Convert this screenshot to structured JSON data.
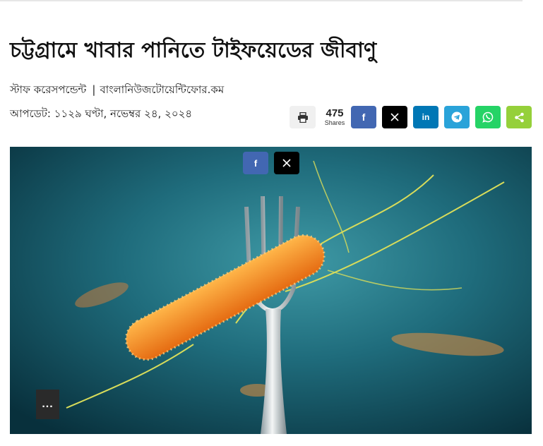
{
  "article": {
    "headline": "চট্টগ্রামে খাবার পানিতে টাইফয়েডের জীবাণু",
    "author": "স্টাফ করেসপন্ডেন্ট",
    "separator": "|",
    "source": "বাংলানিউজটোয়েন্টিফোর.কম",
    "updated": "আপডেট: ১১২৯ ঘণ্টা, নভেম্বর ২৪, ২০২৪"
  },
  "share_bar": {
    "count": "475",
    "count_label": "Shares",
    "buttons": [
      {
        "network": "facebook",
        "icon": "f",
        "color": "#4267b2"
      },
      {
        "network": "twitter",
        "icon": "𝕏",
        "color": "#000000"
      },
      {
        "network": "linkedin",
        "icon": "in",
        "color": "#0077b5"
      },
      {
        "network": "telegram",
        "icon": "telegram-icon",
        "color": "#2aa3d9"
      },
      {
        "network": "whatsapp",
        "icon": "whatsapp-icon",
        "color": "#25d366"
      },
      {
        "network": "sharethis",
        "icon": "share-icon",
        "color": "#95d03a"
      }
    ]
  },
  "overlay_share": {
    "buttons": [
      {
        "network": "facebook",
        "icon": "f",
        "color": "#4267b2"
      },
      {
        "network": "twitter",
        "icon": "𝕏",
        "color": "#000000"
      }
    ]
  },
  "more_button": {
    "label": "..."
  }
}
